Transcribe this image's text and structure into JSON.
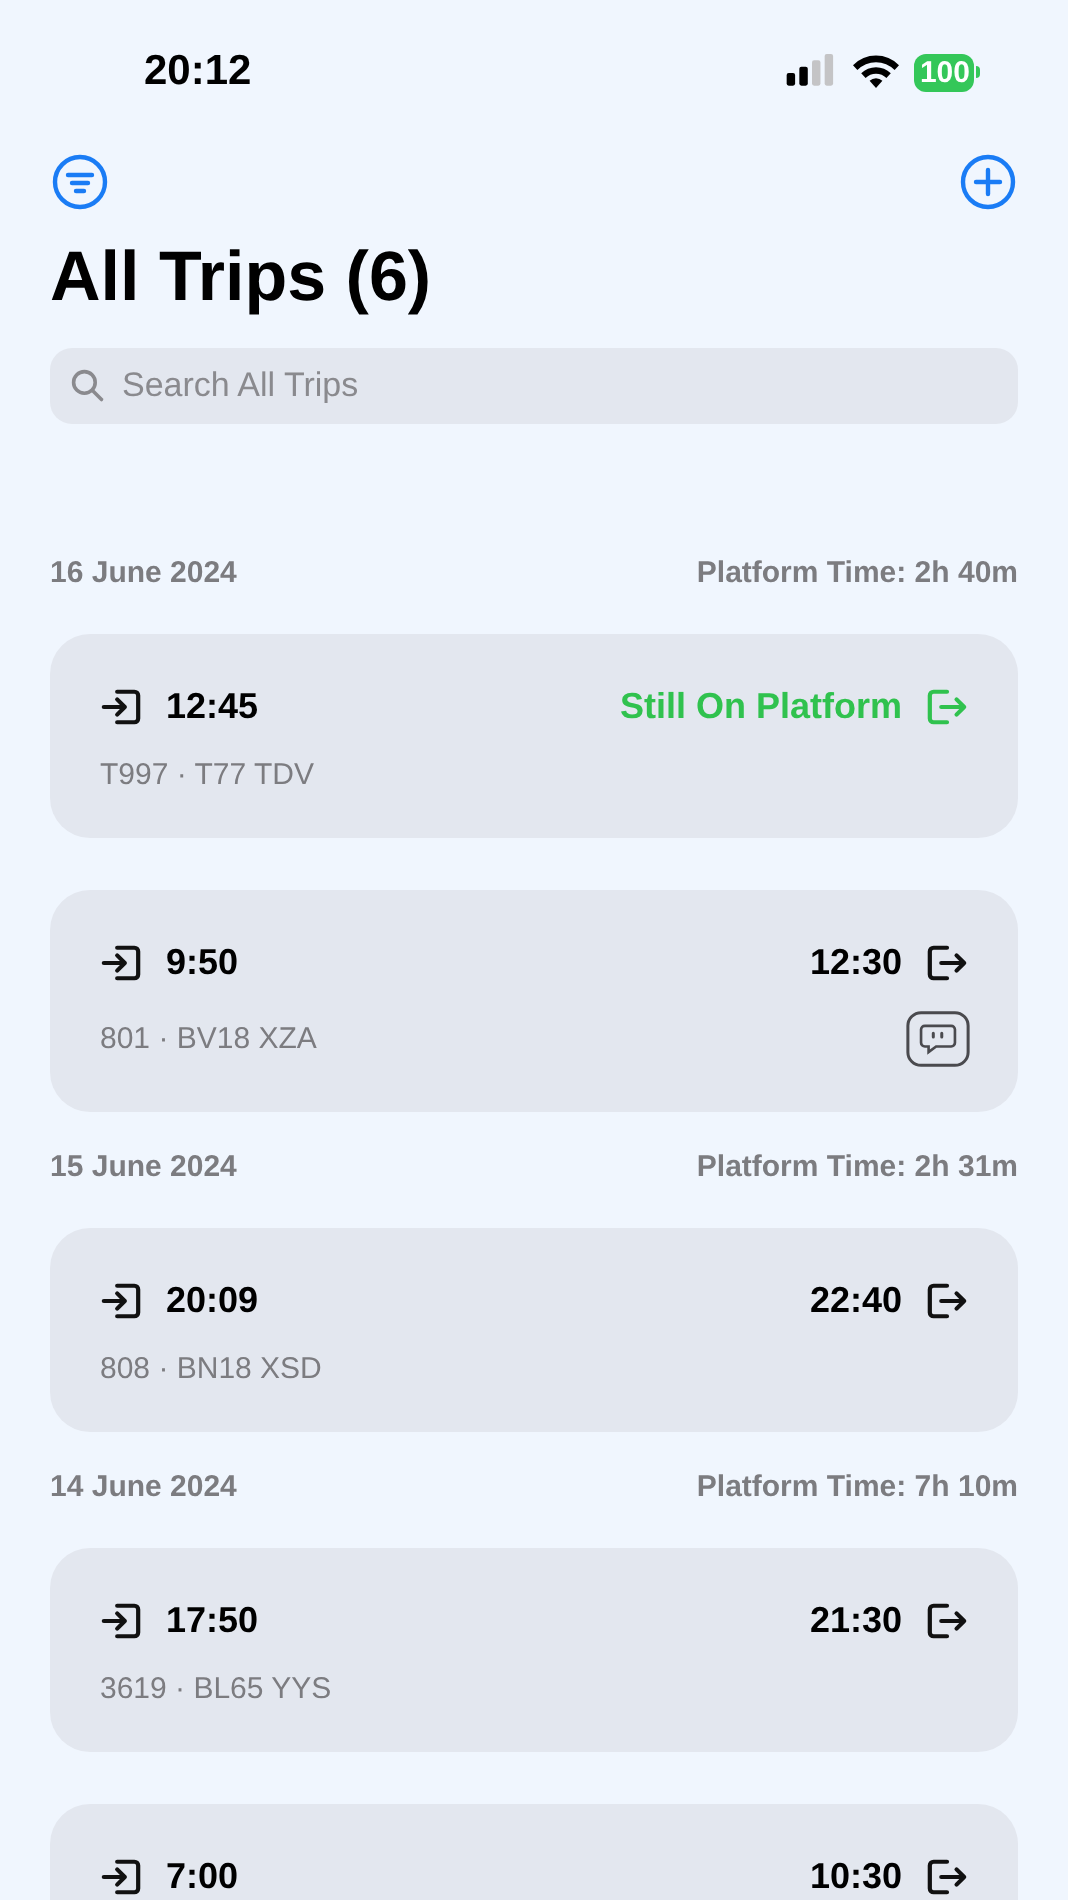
{
  "status_bar": {
    "time": "20:12",
    "battery": "100"
  },
  "title": "All Trips (6)",
  "search": {
    "placeholder": "Search All Trips"
  },
  "sections": [
    {
      "date": "16 June 2024",
      "platform_time": "Platform Time: 2h 40m",
      "trips": [
        {
          "kind": "on_platform",
          "entry_time": "12:45",
          "exit_label": "Still On Platform",
          "details": "T997 · T77 TDV",
          "has_note": false
        },
        {
          "kind": "completed",
          "entry_time": "9:50",
          "exit_label": "12:30",
          "details": "801 · BV18 XZA",
          "has_note": true
        }
      ]
    },
    {
      "date": "15 June 2024",
      "platform_time": "Platform Time: 2h 31m",
      "trips": [
        {
          "kind": "completed",
          "entry_time": "20:09",
          "exit_label": "22:40",
          "details": "808 · BN18 XSD",
          "has_note": false
        }
      ]
    },
    {
      "date": "14 June 2024",
      "platform_time": "Platform Time: 7h 10m",
      "trips": [
        {
          "kind": "completed",
          "entry_time": "17:50",
          "exit_label": "21:30",
          "details": "3619 · BL65 YYS",
          "has_note": false
        },
        {
          "kind": "completed",
          "entry_time": "7:00",
          "exit_label": "10:30"
        }
      ]
    }
  ]
}
